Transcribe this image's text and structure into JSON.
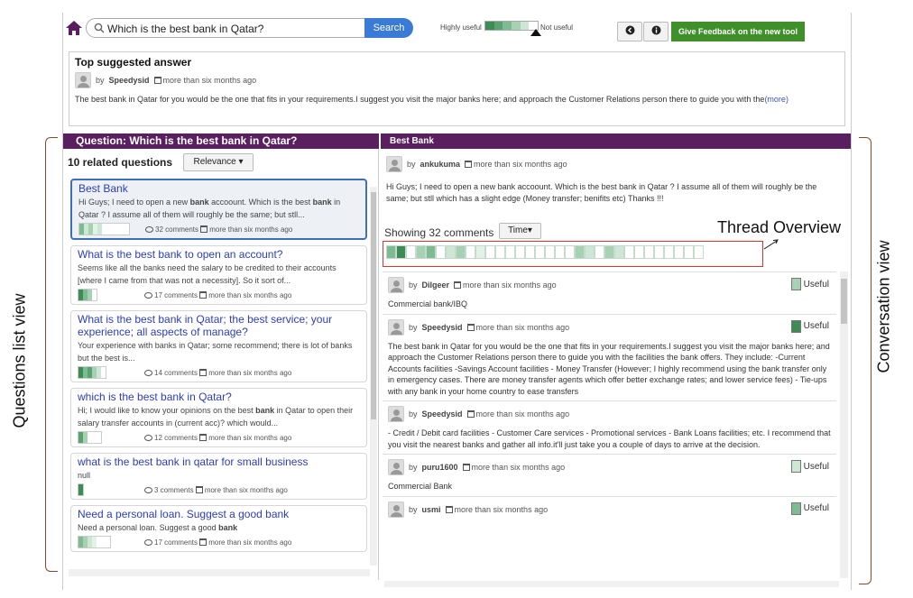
{
  "annotations": {
    "questions_list_view": "Questions list view",
    "conversation_view": "Conversation view",
    "thread_overview": "Thread Overview"
  },
  "topbar": {
    "search_value": "Which is the best bank in Qatar?",
    "search_button": "Search",
    "legend_high": "Highly useful",
    "legend_low": "Not useful",
    "legend_colors": [
      "#3d8b55",
      "#5aa272",
      "#7fbb92",
      "#a6d2b3",
      "#cde6d5",
      "#ffffff"
    ],
    "back_icon": "back-arrow-icon",
    "info_icon": "info-icon",
    "feedback_button": "Give Feedback on the new tool"
  },
  "top_suggested": {
    "title": "Top suggested answer",
    "by": "by",
    "author": "Speedysid",
    "time": "more than six months ago",
    "body": "The best bank in Qatar for you would be the one that fits in your requirements.I suggest you visit the major banks here; and approach the Customer Relations person there to guide you with the",
    "more": "(more)"
  },
  "question_header": "Question: Which is the best bank in Qatar?",
  "left": {
    "related_count": "10 related questions",
    "sort_button": "Relevance ▾",
    "questions": [
      {
        "title": "Best Bank",
        "snippet_html": "Hi Guys; I need to open a new <b>bank</b> accoount. Which is the best <b>bank</b> in Qatar ? I assume all of them will roughly be the same; but stll...",
        "comments": "32 comments",
        "time": "more than six months ago",
        "bar": [
          "#7fbb92",
          "#cde6d5",
          "#a6d2b3",
          "#e3f1e7",
          "#cde6d5",
          "#fff",
          "#fff",
          "#fff",
          "#fff",
          "#fff",
          "#fff"
        ]
      },
      {
        "title": "What is the best bank to open an account?",
        "snippet_html": "Seems like all the banks need the salary to be credited to their accounts [where I came from that was not a necessity]. So it sort of...",
        "comments": "17 comments",
        "time": "more than six months ago",
        "bar": [
          "#3d8b55",
          "#7fbb92",
          "#a6d2b3",
          "#fff"
        ]
      },
      {
        "title": "What is the best bank in Qatar; the best service; your experience; all aspects of manage?",
        "snippet_html": "Your experience with banks in Qatar; some recommend; there is lot of banks but the best is...",
        "comments": "14 comments",
        "time": "more than six months ago",
        "bar": [
          "#3d8b55",
          "#7fbb92",
          "#5aa272",
          "#a6d2b3",
          "#cde6d5",
          "#fff"
        ]
      },
      {
        "title": "which is the best bank in Qatar?",
        "snippet_html": "Hi; I would like to know your opinions on the best <b>bank</b> in Qatar to open their salary transfer accounts in (current acc)? which would...",
        "comments": "12 comments",
        "time": "more than six months ago",
        "bar": [
          "#5aa272",
          "#a6d2b3",
          "#fff",
          "#fff",
          "#fff"
        ]
      },
      {
        "title": "what is the best bank in qatar for small business",
        "snippet_html": "null",
        "comments": "3 comments",
        "time": "more than six months ago",
        "bar": [
          "#3d8b55"
        ]
      },
      {
        "title": "Need a personal loan. Suggest a good bank",
        "snippet_html": "Need a personal loan. Suggest a good <b>bank</b>",
        "comments": "17 comments",
        "time": "more than six months ago",
        "bar": [
          "#7fbb92",
          "#a6d2b3",
          "#cde6d5",
          "#e3f1e7",
          "#fff",
          "#fff",
          "#fff"
        ]
      }
    ]
  },
  "right": {
    "header": "Best Bank",
    "by": "by",
    "author": "ankukuma",
    "time": "more than six months ago",
    "body": "Hi Guys; I need to open a new bank accoount. Which is the best bank in Qatar ? I assume all of them will roughly be the same; but stll which has a slight edge (Money transfer; benifits etc) Thanks !!!",
    "showing": "Showing 32 comments",
    "time_button": "Time▾",
    "thread_cells": [
      "#7fbb92",
      "#3d8b55",
      "#fff",
      "#a6d2b3",
      "#7fbb92",
      "#fff",
      "#cde6d5",
      "#a6d2b3",
      "#fff",
      "#e3f1e7",
      "#fff",
      "#fff",
      "#fff",
      "#fff",
      "#fff",
      "#fff",
      "#fff",
      "#fff",
      "#fff",
      "#a6d2b3",
      "#cde6d5",
      "#fff",
      "#a6d2b3",
      "#cde6d5",
      "#fff",
      "#fff",
      "#fff",
      "#fff",
      "#fff",
      "#fff",
      "#fff",
      "#fff"
    ],
    "comments": [
      {
        "author": "Dilgeer",
        "time": "more than six months ago",
        "useful": "Useful",
        "useful_color": "#a6d2b3",
        "body": "Commercial bank/IBQ"
      },
      {
        "author": "Speedysid",
        "time": "more than six months ago",
        "useful": "Useful",
        "useful_color": "#3d8b55",
        "body": "The best bank in Qatar for you would be the one that fits in your requirements.I suggest you visit the major banks here; and approach the Customer Relations person there to guide you with the facilities the bank offers. They include: -Current Accounts facilities -Savings Account facilities - Money Transfer (However; I highly recommend using the bank transfer only in emergency cases. There are money transfer agents which offer better exchange rates; and lower service fees) - Tie-ups with any bank in your home country to ease transfers"
      },
      {
        "author": "Speedysid",
        "time": "more than six months ago",
        "useful": "",
        "useful_color": "",
        "body": "- Credit / Debit card facilities - Customer Care services - Promotional services - Bank Loans facilities; etc. I recommend that you visit the nearest banks and gather all info.it'll just take you a couple of days to arrive at the decision."
      },
      {
        "author": "puru1600",
        "time": "more than six months ago",
        "useful": "Useful",
        "useful_color": "#cde6d5",
        "body": "Commercial Bank"
      },
      {
        "author": "usmi",
        "time": "more than six months ago",
        "useful": "Useful",
        "useful_color": "#7fbb92",
        "body": ""
      }
    ]
  }
}
